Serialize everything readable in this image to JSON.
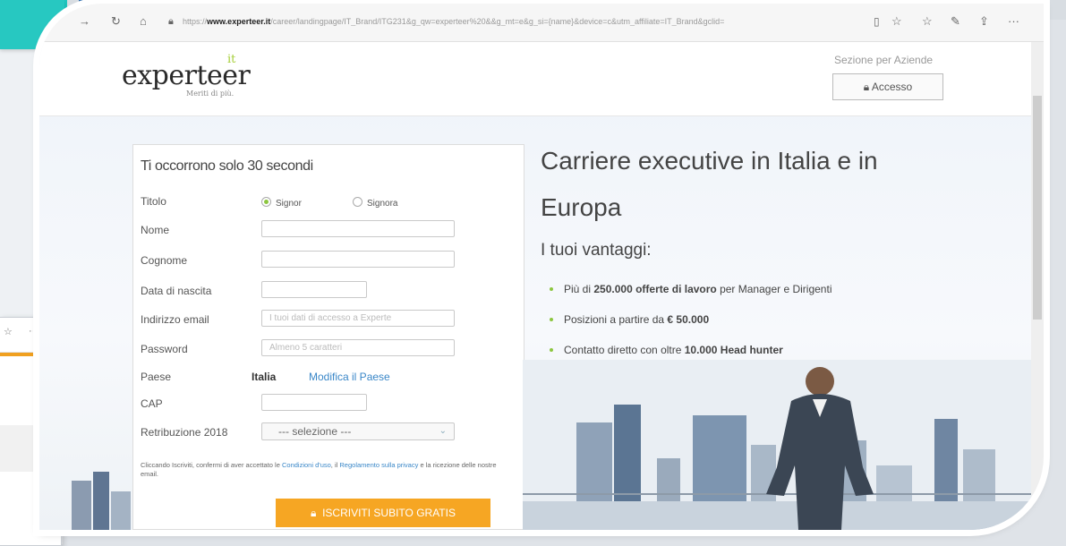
{
  "browser": {
    "url_prefix": "https://",
    "url_domain": "www.experteer.it",
    "url_rest": "/career/landingpage/IT_Brand/ITG231&g_qw=experteer%20&&g_mt=e&g_si={name}&device=c&utm_affiliate=IT_Brand&gclid=",
    "icons": [
      "back-icon",
      "refresh-icon",
      "home-icon",
      "lock-icon",
      "reading-view-icon",
      "favorite-icon",
      "favorites-bar-icon",
      "pen-icon",
      "share-icon",
      "more-icon"
    ]
  },
  "header": {
    "logo_text": "experteer",
    "logo_sup": "it",
    "logo_tagline": "Meriti di più.",
    "company_section": "Sezione per Aziende",
    "login_label": "Accesso"
  },
  "form": {
    "title": "Ti occorrono solo 30 secondi",
    "titolo_label": "Titolo",
    "radio_signor": "Signor",
    "radio_signora": "Signora",
    "nome_label": "Nome",
    "cognome_label": "Cognome",
    "nascita_label": "Data di nascita",
    "email_label": "Indirizzo email",
    "email_placeholder": "I tuoi dati di accesso a Experte",
    "password_label": "Password",
    "password_placeholder": "Almeno 5 caratteri",
    "paese_label": "Paese",
    "paese_value": "Italia",
    "paese_link": "Modifica il Paese",
    "cap_label": "CAP",
    "retribuzione_label": "Retribuzione 2018",
    "retribuzione_value": "--- selezione ---",
    "terms_1": "Cliccando Iscriviti, confermi di aver accettato le ",
    "terms_link1": "Condizioni d'uso",
    "terms_2": ", il ",
    "terms_link2": "Regolamento sulla privacy",
    "terms_3": " e la ricezione delle nostre email.",
    "submit": "ISCRIVITI SUBITO GRATIS"
  },
  "hero": {
    "title": "Carriere executive in Italia e in Europa",
    "subtitle": "I tuoi vantaggi:",
    "benefit1_pre": "Più di ",
    "benefit1_bold": "250.000 offerte di lavoro",
    "benefit1_post": " per Manager e Dirigenti",
    "benefit2_pre": "Posizioni a partire da ",
    "benefit2_bold": "€ 50.000",
    "benefit3_pre": "Contatto diretto con oltre ",
    "benefit3_bold": "10.000 Head hunter"
  },
  "colors": {
    "accent_green": "#8cc63f",
    "cta_orange": "#f6a623",
    "link_blue": "#3a87c8",
    "top_blue": "#2f6fb0",
    "teal": "#27c8c1"
  }
}
